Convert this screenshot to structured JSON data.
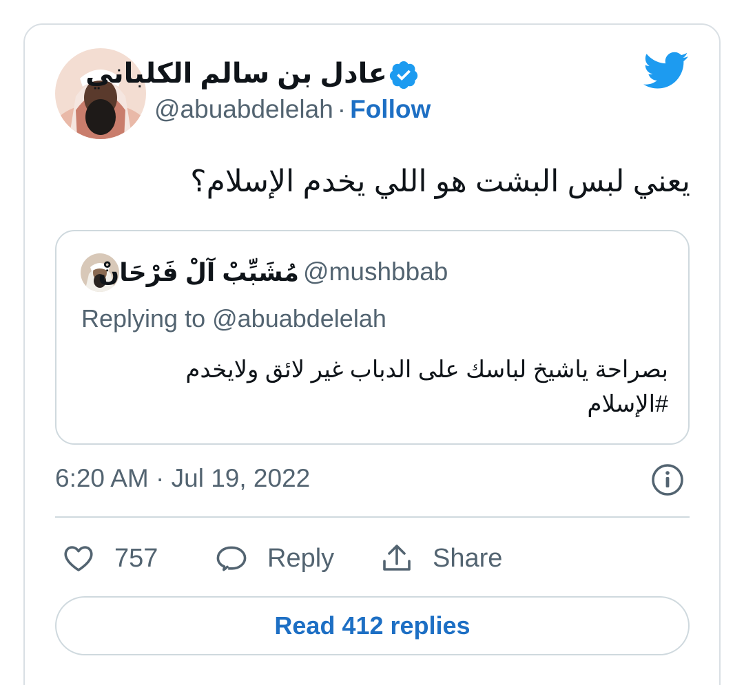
{
  "author": {
    "display_name": "عادل بن سالم الكلباني",
    "handle": "@abuabdelelah",
    "separator": "·",
    "follow_label": "Follow",
    "avatar_icon": "avatar-photo-icon",
    "verified_icon": "verified-badge-icon"
  },
  "tweet": {
    "text": "يعني لبس البشت هو اللي يخدم الإسلام؟",
    "timestamp": "6:20 AM · Jul 19, 2022"
  },
  "quoted_tweet": {
    "display_name": "مُشَبِّبْ آلْ فَرْحَانْ",
    "handle": "@mushbbab",
    "replying_to": "Replying to @abuabdelelah",
    "text_line1": "بصراحة ياشيخ لباسك على الدباب غير لائق ولايخدم",
    "text_line2": "#الإسلام"
  },
  "actions": {
    "like_count": "757",
    "reply_label": "Reply",
    "share_label": "Share",
    "read_replies_label": "Read 412 replies"
  },
  "colors": {
    "twitter_blue": "#1d9bf0",
    "link_blue": "#1d6fc4",
    "text_primary": "#0f1419",
    "text_secondary": "#536471",
    "border": "#cfd9de"
  }
}
